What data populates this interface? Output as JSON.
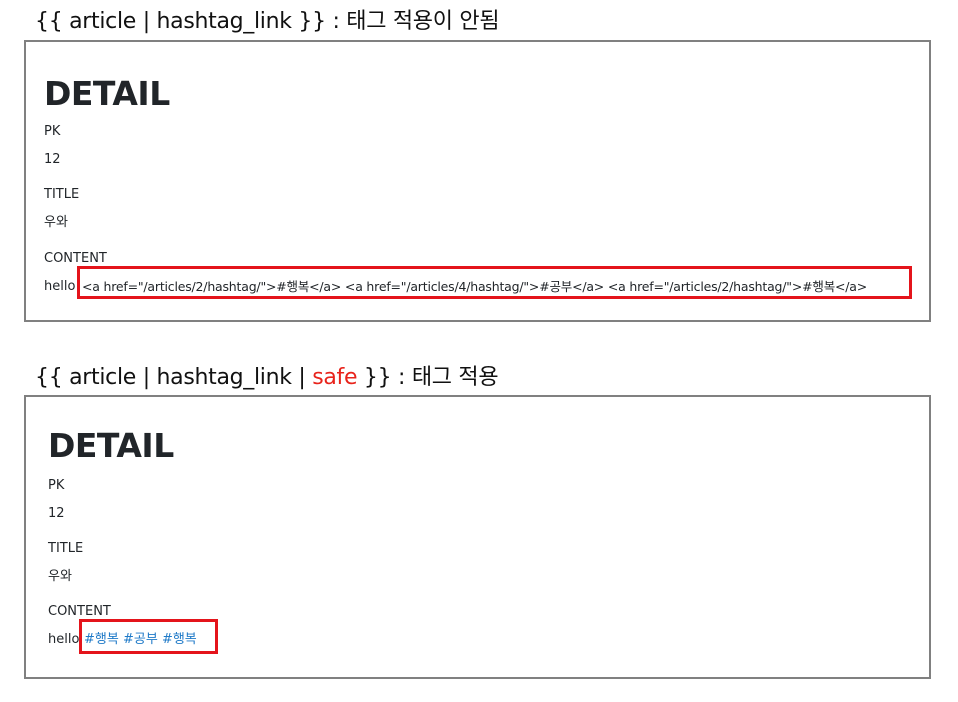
{
  "example1": {
    "caption": "{{ article | hashtag_link }} : 태그 적용이 안됨",
    "heading": "DETAIL",
    "pk_label": "PK",
    "pk_value": "12",
    "title_label": "TITLE",
    "title_value": "우와",
    "content_label": "CONTENT",
    "content_prefix": "hello",
    "content_raw": "<a href=\"/articles/2/hashtag/\">#행복</a> <a href=\"/articles/4/hashtag/\">#공부</a> <a href=\"/articles/2/hashtag/\">#행복</a>"
  },
  "example2": {
    "caption_before": "{{ article | hashtag_link | ",
    "caption_safe": "safe",
    "caption_after": " }} : 태그 적용",
    "heading": "DETAIL",
    "pk_label": "PK",
    "pk_value": "12",
    "title_label": "TITLE",
    "title_value": "우와",
    "content_label": "CONTENT",
    "content_prefix": "hello",
    "tags": [
      "#행복",
      "#공부",
      "#행복"
    ]
  },
  "colors": {
    "highlight": "#e4141b",
    "safe_text": "#e8231b",
    "link": "#1f7ac8",
    "panel_border": "#808080"
  }
}
